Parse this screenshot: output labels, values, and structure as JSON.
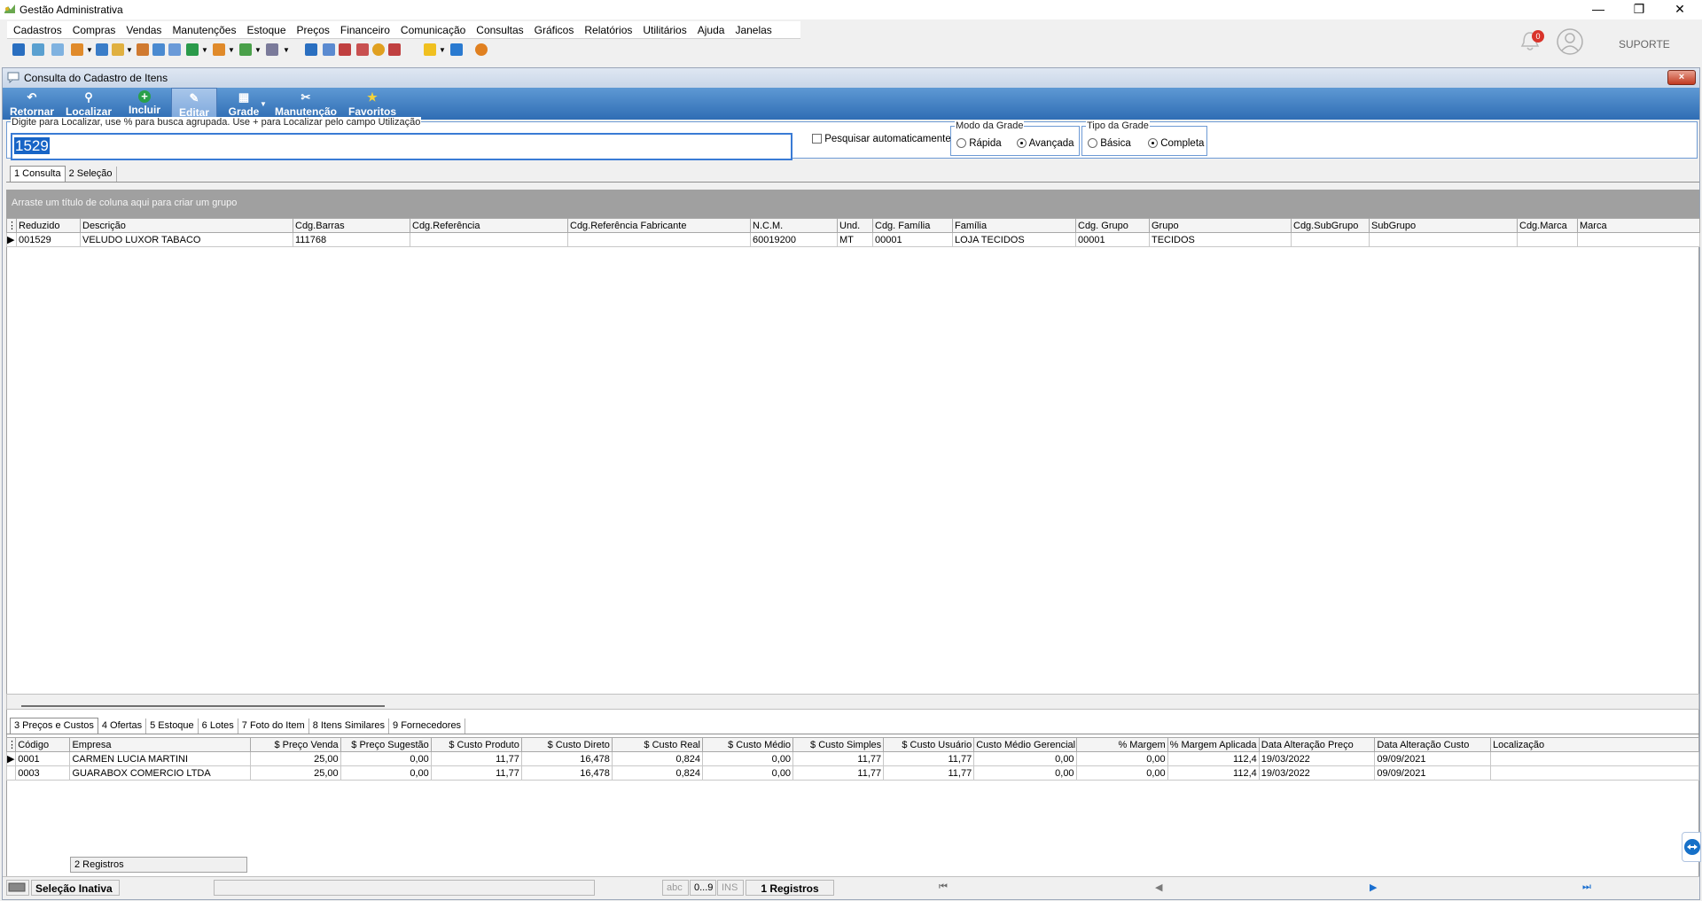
{
  "window": {
    "title": "Gestão Administrativa",
    "user": "SUPORTE",
    "notif_count": "0"
  },
  "menu": [
    "Cadastros",
    "Compras",
    "Vendas",
    "Manutenções",
    "Estoque",
    "Preços",
    "Financeiro",
    "Comunicação",
    "Consultas",
    "Gráficos",
    "Relatórios",
    "Utilitários",
    "Ajuda",
    "Janelas"
  ],
  "form": {
    "title": "Consulta do Cadastro de Itens",
    "close": "×",
    "ribbon": [
      {
        "label": "Retornar",
        "icon": "undo-icon"
      },
      {
        "label": "Localizar",
        "icon": "magnifier-icon"
      },
      {
        "label": "Incluir",
        "icon": "plus-icon"
      },
      {
        "label": "Editar",
        "icon": "edit-icon"
      },
      {
        "label": "Grade",
        "icon": "grid-icon"
      },
      {
        "label": "Manutenção",
        "icon": "tools-icon"
      },
      {
        "label": "Favoritos",
        "icon": "star-icon"
      }
    ],
    "search_hint": "Digite para Localizar, use % para busca agrupada. Use + para Localizar pelo campo Utilização",
    "search_value": "1529",
    "auto_search_label": "Pesquisar automaticamente",
    "modo_grade": {
      "label": "Modo da Grade",
      "opt1": "Rápida",
      "opt2": "Avançada",
      "selected": "Avançada"
    },
    "tipo_grade": {
      "label": "Tipo da Grade",
      "opt1": "Básica",
      "opt2": "Completa",
      "selected": "Completa"
    },
    "tabs": [
      "1 Consulta",
      "2 Seleção"
    ],
    "group_hint": "Arraste um título de coluna aqui para criar um grupo",
    "main_columns": [
      "Reduzido",
      "Descrição",
      "Cdg.Barras",
      "Cdg.Referência",
      "Cdg.Referência Fabricante",
      "N.C.M.",
      "Und.",
      "Cdg. Família",
      "Família",
      "Cdg. Grupo",
      "Grupo",
      "Cdg.SubGrupo",
      "SubGrupo",
      "Cdg.Marca",
      "Marca"
    ],
    "main_rows": [
      [
        "001529",
        "VELUDO LUXOR TABACO",
        "111768",
        "",
        "",
        "60019200",
        "MT",
        "00001",
        "LOJA TECIDOS",
        "00001",
        "TECIDOS",
        "",
        "",
        "",
        ""
      ]
    ],
    "detail_tabs": [
      "3 Preços e Custos",
      "4 Ofertas",
      "5 Estoque",
      "6 Lotes",
      "7 Foto do Item",
      "8 Itens Similares",
      "9 Fornecedores"
    ],
    "detail_columns": [
      "Código",
      "Empresa",
      "$ Preço Venda",
      "$ Preço Sugestão",
      "$ Custo Produto",
      "$ Custo Direto",
      "$ Custo Real",
      "$ Custo Médio",
      "$ Custo Simples",
      "$ Custo Usuário",
      "Custo Médio Gerencial",
      "% Margem",
      "% Margem Aplicada",
      "Data Alteração Preço",
      "Data Alteração Custo",
      "Localização"
    ],
    "detail_rows": [
      [
        "0001",
        "CARMEN LUCIA MARTINI",
        "25,00",
        "0,00",
        "11,77",
        "16,478",
        "0,824",
        "0,00",
        "11,77",
        "11,77",
        "0,00",
        "0,00",
        "112,4",
        "19/03/2022",
        "09/09/2021",
        ""
      ],
      [
        "0003",
        "GUARABOX COMERCIO LTDA",
        "25,00",
        "0,00",
        "11,77",
        "16,478",
        "0,824",
        "0,00",
        "11,77",
        "11,77",
        "0,00",
        "0,00",
        "112,4",
        "19/03/2022",
        "09/09/2021",
        ""
      ]
    ],
    "detail_footer": "2 Registros",
    "status": {
      "selection": "Seleção Inativa",
      "abc": "abc",
      "digits": "0...9",
      "ins": "INS",
      "records": "1 Registros"
    }
  }
}
